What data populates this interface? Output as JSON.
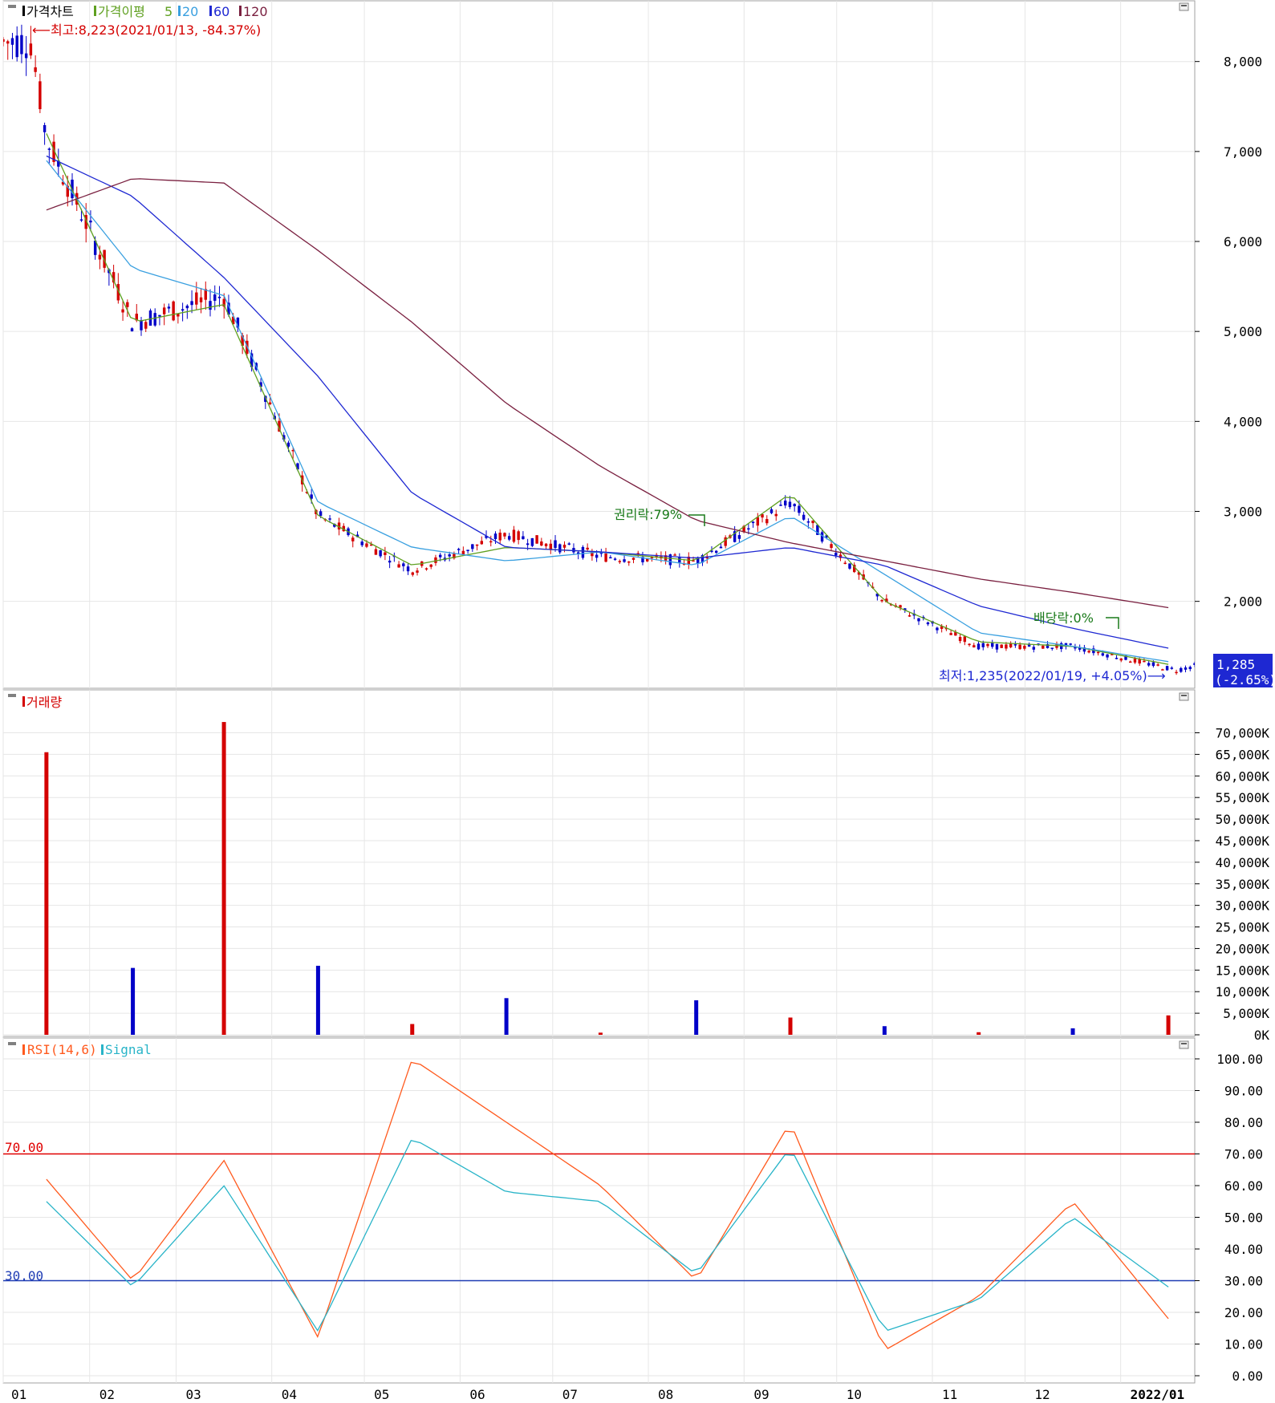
{
  "colors": {
    "up": "#d40000",
    "down": "#0000c8",
    "ma5": "#5fa020",
    "ma20": "#3aa0e0",
    "ma60": "#1e28d2",
    "ma120": "#7a2040",
    "rsi": "#ff5a1e",
    "signal": "#28b4c8",
    "line70": "#e00000",
    "line30": "#1e3cb4",
    "grid": "#e6e6e6",
    "border": "#a0a0a0",
    "priceBox": "#1e28d2"
  },
  "price_panel": {
    "title": "가격차트",
    "ma_title": "가격이평",
    "ma_periods": [
      "5",
      "20",
      "60",
      "120"
    ],
    "high_note": "⟵최고:8,223(2021/01/13, -84.37%)",
    "low_note": "최저:1,235(2022/01/19, +4.05%)⟶",
    "rights_note": "권리락:79%",
    "dividend_note": "배당락:0%",
    "last_price": "1,285",
    "last_change": "(-2.65%)",
    "y_ticks": [
      "8,000",
      "7,000",
      "6,000",
      "5,000",
      "4,000",
      "3,000",
      "2,000"
    ]
  },
  "volume_panel": {
    "title": "거래량",
    "y_ticks": [
      "70,000K",
      "65,000K",
      "60,000K",
      "55,000K",
      "50,000K",
      "45,000K",
      "40,000K",
      "35,000K",
      "30,000K",
      "25,000K",
      "20,000K",
      "15,000K",
      "10,000K",
      "5,000K",
      "0K"
    ]
  },
  "rsi_panel": {
    "title": "RSI(14,6)",
    "signal_title": "Signal",
    "level_high": "70.00",
    "level_low": "30.00",
    "y_ticks": [
      "100.00",
      "90.00",
      "80.00",
      "70.00",
      "60.00",
      "50.00",
      "40.00",
      "30.00",
      "20.00",
      "10.00",
      "0.00"
    ]
  },
  "x_ticks": [
    "01",
    "02",
    "03",
    "04",
    "05",
    "06",
    "07",
    "08",
    "09",
    "10",
    "11",
    "12",
    "2022/01"
  ],
  "chart_data": [
    {
      "type": "candlestick",
      "title": "가격차트",
      "x_labels": [
        "01",
        "02",
        "03",
        "04",
        "05",
        "06",
        "07",
        "08",
        "09",
        "10",
        "11",
        "12",
        "2022/01"
      ],
      "ylim": [
        1150,
        8550
      ],
      "x_start": "2021/01/04",
      "x_end": "2022/01/25",
      "anchors": [
        {
          "month": "2021/01",
          "price": 7150
        },
        {
          "date": "2021/01/13",
          "price": 8223
        },
        {
          "month": "2021/02",
          "price": 5100
        },
        {
          "month": "2021/03",
          "price": 5400
        },
        {
          "month": "2021/04",
          "price": 2950
        },
        {
          "month": "2021/05",
          "price": 2350
        },
        {
          "month": "2021/06",
          "price": 2750
        },
        {
          "month": "2021/07",
          "price": 2500
        },
        {
          "month": "2021/08",
          "price": 2450
        },
        {
          "month": "2021/09",
          "price": 3100
        },
        {
          "month": "2021/10",
          "price": 2000
        },
        {
          "month": "2021/11",
          "price": 1500
        },
        {
          "month": "2021/12",
          "price": 1500
        },
        {
          "date": "2022/01/19",
          "price": 1235
        },
        {
          "date": "2022/01/25",
          "price": 1285
        }
      ],
      "series": [
        {
          "name": "5",
          "values": [
            7200,
            5100,
            5300,
            2950,
            2400,
            2600,
            2550,
            2450,
            3200,
            2000,
            1550,
            1500,
            1300
          ]
        },
        {
          "name": "20",
          "values": [
            6900,
            5700,
            5400,
            3100,
            2600,
            2450,
            2550,
            2400,
            2950,
            2300,
            1650,
            1500,
            1330
          ]
        },
        {
          "name": "60",
          "values": [
            6950,
            6500,
            5600,
            4500,
            3200,
            2600,
            2550,
            2480,
            2600,
            2400,
            1950,
            1700,
            1480
          ]
        },
        {
          "name": "120",
          "values": [
            6350,
            6700,
            6650,
            5900,
            5100,
            4200,
            3500,
            2900,
            2650,
            2450,
            2250,
            2100,
            1930
          ]
        }
      ]
    },
    {
      "type": "bar",
      "title": "거래량",
      "ylim": [
        0,
        74000
      ],
      "unit": "K",
      "categories": [
        "01",
        "02",
        "03",
        "04",
        "05",
        "06",
        "07",
        "08",
        "09",
        "10",
        "11",
        "12",
        "2022/01"
      ],
      "values": [
        65500,
        15500,
        72500,
        16000,
        2500,
        8500,
        500,
        8000,
        4000,
        2000,
        600,
        1500,
        4500
      ]
    },
    {
      "type": "line",
      "title": "RSI(14,6)",
      "ylim": [
        0,
        100
      ],
      "levels": [
        70,
        30
      ],
      "categories": [
        "01",
        "02",
        "03",
        "04",
        "05",
        "06",
        "07",
        "08",
        "09",
        "10",
        "11",
        "12",
        "2022/01"
      ],
      "series": [
        {
          "name": "RSI(14,6)",
          "values": [
            62,
            30,
            68,
            12,
            100,
            80,
            60,
            30,
            80,
            8,
            25,
            55,
            18
          ]
        },
        {
          "name": "Signal",
          "values": [
            55,
            28,
            60,
            14,
            75,
            58,
            55,
            32,
            72,
            14,
            24,
            50,
            28
          ]
        }
      ]
    }
  ]
}
